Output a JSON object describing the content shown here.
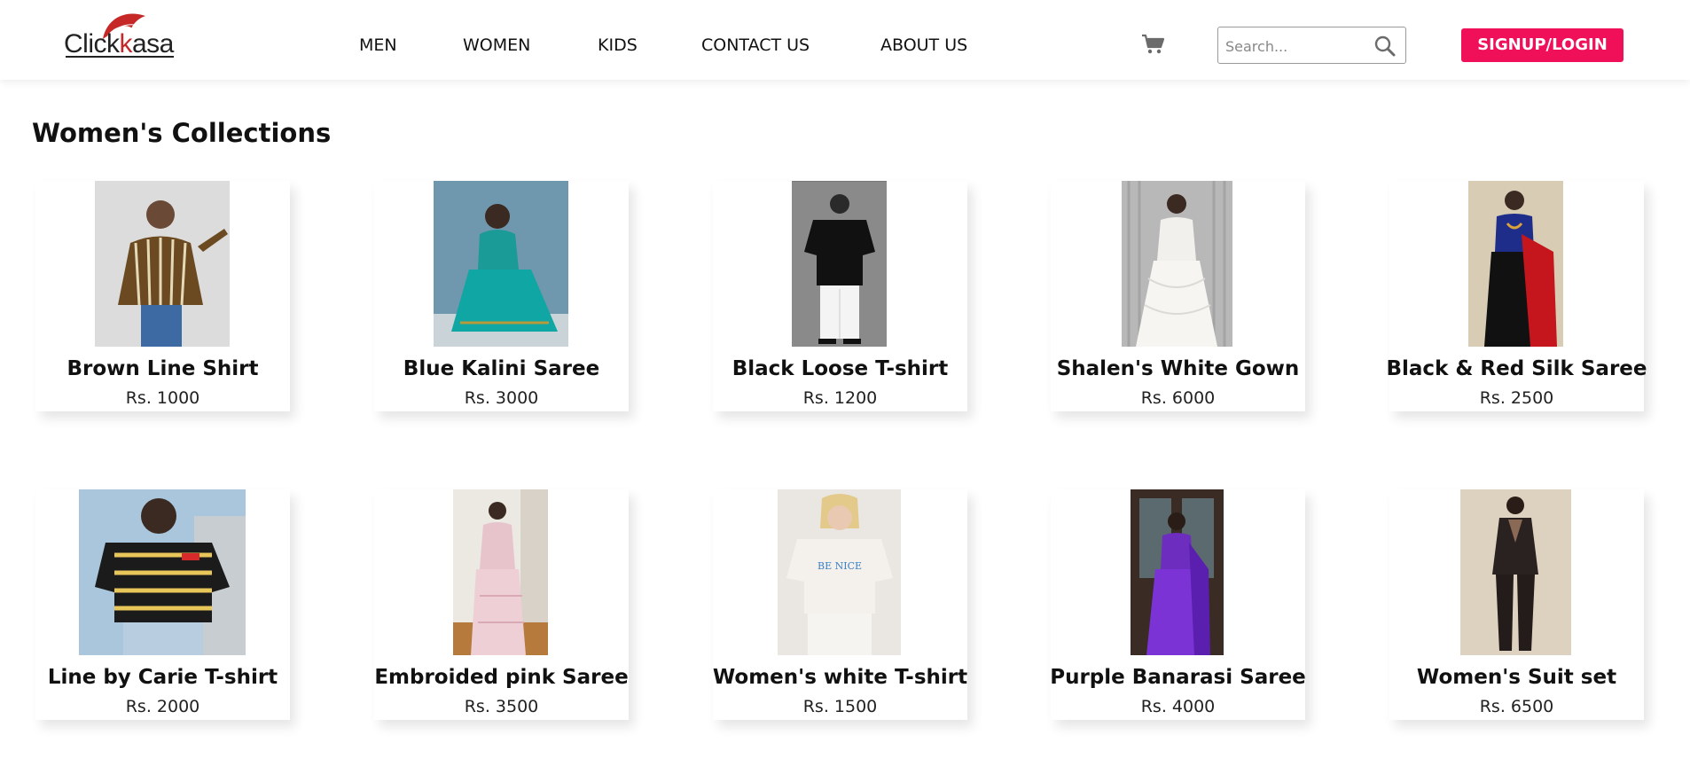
{
  "header": {
    "logo": {
      "text_left": "Click",
      "text_right": "asa"
    },
    "nav": [
      {
        "label": "MEN"
      },
      {
        "label": "WOMEN"
      },
      {
        "label": "KIDS"
      },
      {
        "label": "CONTACT US"
      },
      {
        "label": "ABOUT US"
      }
    ],
    "cart_icon": "shopping-cart-icon",
    "search": {
      "placeholder": "Search...",
      "value": "",
      "icon": "magnifier-icon"
    },
    "signup_label": "SIGNUP/LOGIN"
  },
  "main": {
    "title": "Women's Collections",
    "products": [
      {
        "name": "Brown Line Shirt",
        "price": "Rs. 1000"
      },
      {
        "name": "Blue Kalini Saree",
        "price": "Rs. 3000"
      },
      {
        "name": "Black Loose T-shirt",
        "price": "Rs. 1200"
      },
      {
        "name": "Shalen's White Gown",
        "price": "Rs. 6000"
      },
      {
        "name": "Black & Red Silk Saree",
        "price": "Rs. 2500"
      },
      {
        "name": "Line by Carie T-shirt",
        "price": "Rs. 2000"
      },
      {
        "name": "Embroided pink Saree",
        "price": "Rs. 3500"
      },
      {
        "name": "Women's white T-shirt",
        "price": "Rs. 1500"
      },
      {
        "name": "Purple Banarasi Saree",
        "price": "Rs. 4000"
      },
      {
        "name": "Women's Suit set",
        "price": "Rs. 6500"
      }
    ]
  },
  "colors": {
    "accent": "#f0105a",
    "logo_red": "#c62828",
    "text": "#111111"
  }
}
